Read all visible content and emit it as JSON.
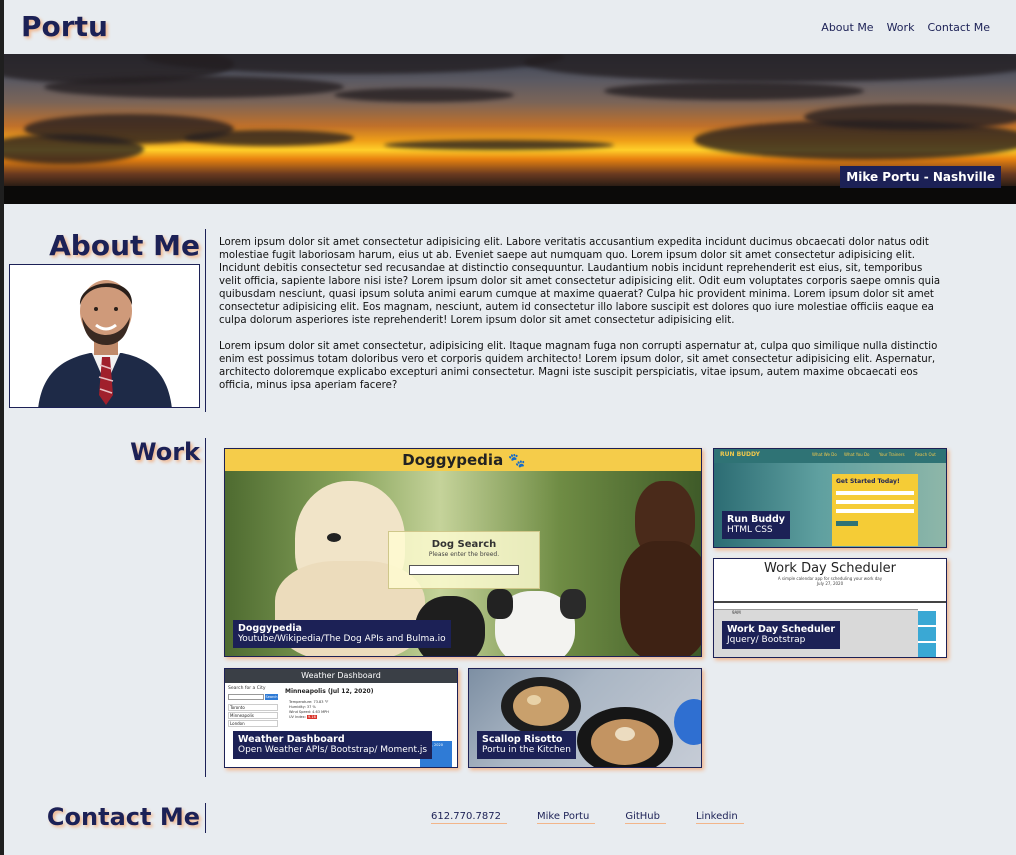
{
  "header": {
    "brand": "Portu",
    "nav": [
      "About Me",
      "Work",
      "Contact Me"
    ]
  },
  "hero": {
    "caption": "Mike Portu - Nashville"
  },
  "about": {
    "title": "About Me",
    "paragraphs": [
      "Lorem ipsum dolor sit amet consectetur adipisicing elit. Labore veritatis accusantium expedita incidunt ducimus obcaecati dolor natus odit molestiae fugit laboriosam harum, eius ut ab. Eveniet saepe aut numquam quo. Lorem ipsum dolor sit amet consectetur adipisicing elit. Incidunt debitis consectetur sed recusandae at distinctio consequuntur. Laudantium nobis incidunt reprehenderit est eius, sit, temporibus velit officia, sapiente labore nisi iste? Lorem ipsum dolor sit amet consectetur adipisicing elit. Odit eum voluptates corporis saepe omnis quia quibusdam nesciunt, quasi ipsum soluta animi earum cumque at maxime quaerat? Culpa hic provident minima. Lorem ipsum dolor sit amet consectetur adipisicing elit. Eos magnam, nesciunt, autem id consectetur illo labore suscipit est dolores quo iure molestiae officiis eaque ea culpa dolorum asperiores iste reprehenderit! Lorem ipsum dolor sit amet consectetur adipisicing elit.",
      "Lorem ipsum dolor sit amet consectetur, adipisicing elit. Itaque magnam fuga non corrupti aspernatur at, culpa quo similique nulla distinctio enim est possimus totam doloribus vero et corporis quidem architecto! Lorem ipsum dolor, sit amet consectetur adipisicing elit. Aspernatur, architecto doloremque explicabo excepturi animi consectetur. Magni iste suscipit perspiciatis, vitae ipsum, autem maxime obcaecati eos officia, minus ipsa aperiam facere?"
    ]
  },
  "work": {
    "title": "Work",
    "projects": [
      {
        "name": "Doggypedia",
        "tech": "Youtube/Wikipedia/The Dog APIs and Bulma.io",
        "screenshot_title": "Doggypedia",
        "search_title": "Dog Search",
        "search_hint": "Please enter the breed."
      },
      {
        "name": "Run Buddy",
        "tech": "HTML CSS",
        "screenshot_brand": "RUN BUDDY",
        "screenshot_nav": [
          "What We Do",
          "What You Do",
          "Your Trainers",
          "Reach Out"
        ],
        "form_title": "Get Started Today!"
      },
      {
        "name": "Work Day Scheduler",
        "tech": "Jquery/ Bootstrap",
        "screenshot_title": "Work Day Scheduler",
        "screenshot_sub": "A simple calendar app for scheduling your work day",
        "screenshot_date": "July 27, 2020",
        "screenshot_hour": "9AM"
      },
      {
        "name": "Weather Dashboard",
        "tech": "Open Weather APIs/ Bootstrap/ Moment.js",
        "screenshot_header": "Weather Dashboard",
        "screenshot_side": "Search for a City",
        "screenshot_search_button": "Search",
        "screenshot_cities": [
          "Toronto",
          "Minneapolis",
          "London"
        ],
        "screenshot_city": "Minneapolis (Jul 12, 2020)",
        "screenshot_details": [
          "Temperature: 73.83 °F",
          "Humidity: 37 %",
          "Wind Speed: 4.63 MPH",
          "UV Index:"
        ],
        "screenshot_uv": "9.16",
        "screenshot_forecast_date": "Jul 13, 2020"
      },
      {
        "name": "Scallop Risotto",
        "tech": "Portu in the Kitchen"
      }
    ]
  },
  "contact": {
    "title": "Contact Me",
    "links": [
      "612.770.7872",
      "Mike Portu",
      "GitHub",
      "Linkedin"
    ]
  },
  "colors": {
    "navy": "#1c2156",
    "peach": "#f2b58a",
    "background": "#e8ecf0"
  }
}
